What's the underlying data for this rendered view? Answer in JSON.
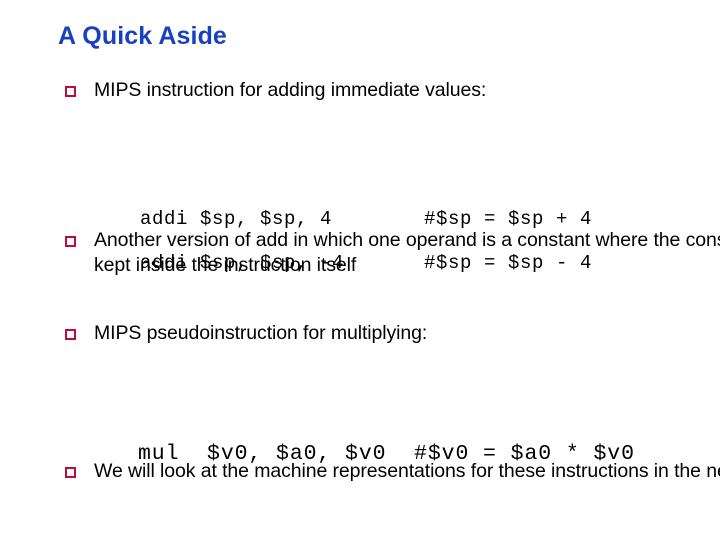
{
  "slide": {
    "title": "A Quick Aside",
    "title_color": "#1A3FC0",
    "background_color": "#FFFFFF",
    "bullet_marker_color": "#C00A3C",
    "body_text_color": "#000000"
  },
  "bullets": [
    {
      "id": "bullet-mips-addi",
      "marker": "hollow-square-bullet",
      "text": "MIPS instruction for adding immediate values:"
    },
    {
      "id": "bullet-another-version",
      "marker": "hollow-square-bullet",
      "text": "Another version of add in which one operand is a constant where the constant is kept inside the instruction itself"
    },
    {
      "id": "bullet-pseudoinstruction",
      "marker": "hollow-square-bullet",
      "text": "MIPS pseudoinstruction for multiplying:"
    },
    {
      "id": "bullet-next-lecture",
      "marker": "hollow-square-bullet",
      "text": "We will look at the machine representations for these instructions in the next lecture"
    }
  ],
  "code": {
    "addi_positive": {
      "instruction": "addi $sp, $sp, 4",
      "comment": "#$sp = $sp + 4"
    },
    "addi_negative": {
      "instruction": "addi $sp, $sp, -4",
      "comment": "#$sp = $sp - 4"
    },
    "mul": {
      "line": "mul  $v0, $a0, $v0  #$v0 = $a0 * $v0"
    }
  }
}
